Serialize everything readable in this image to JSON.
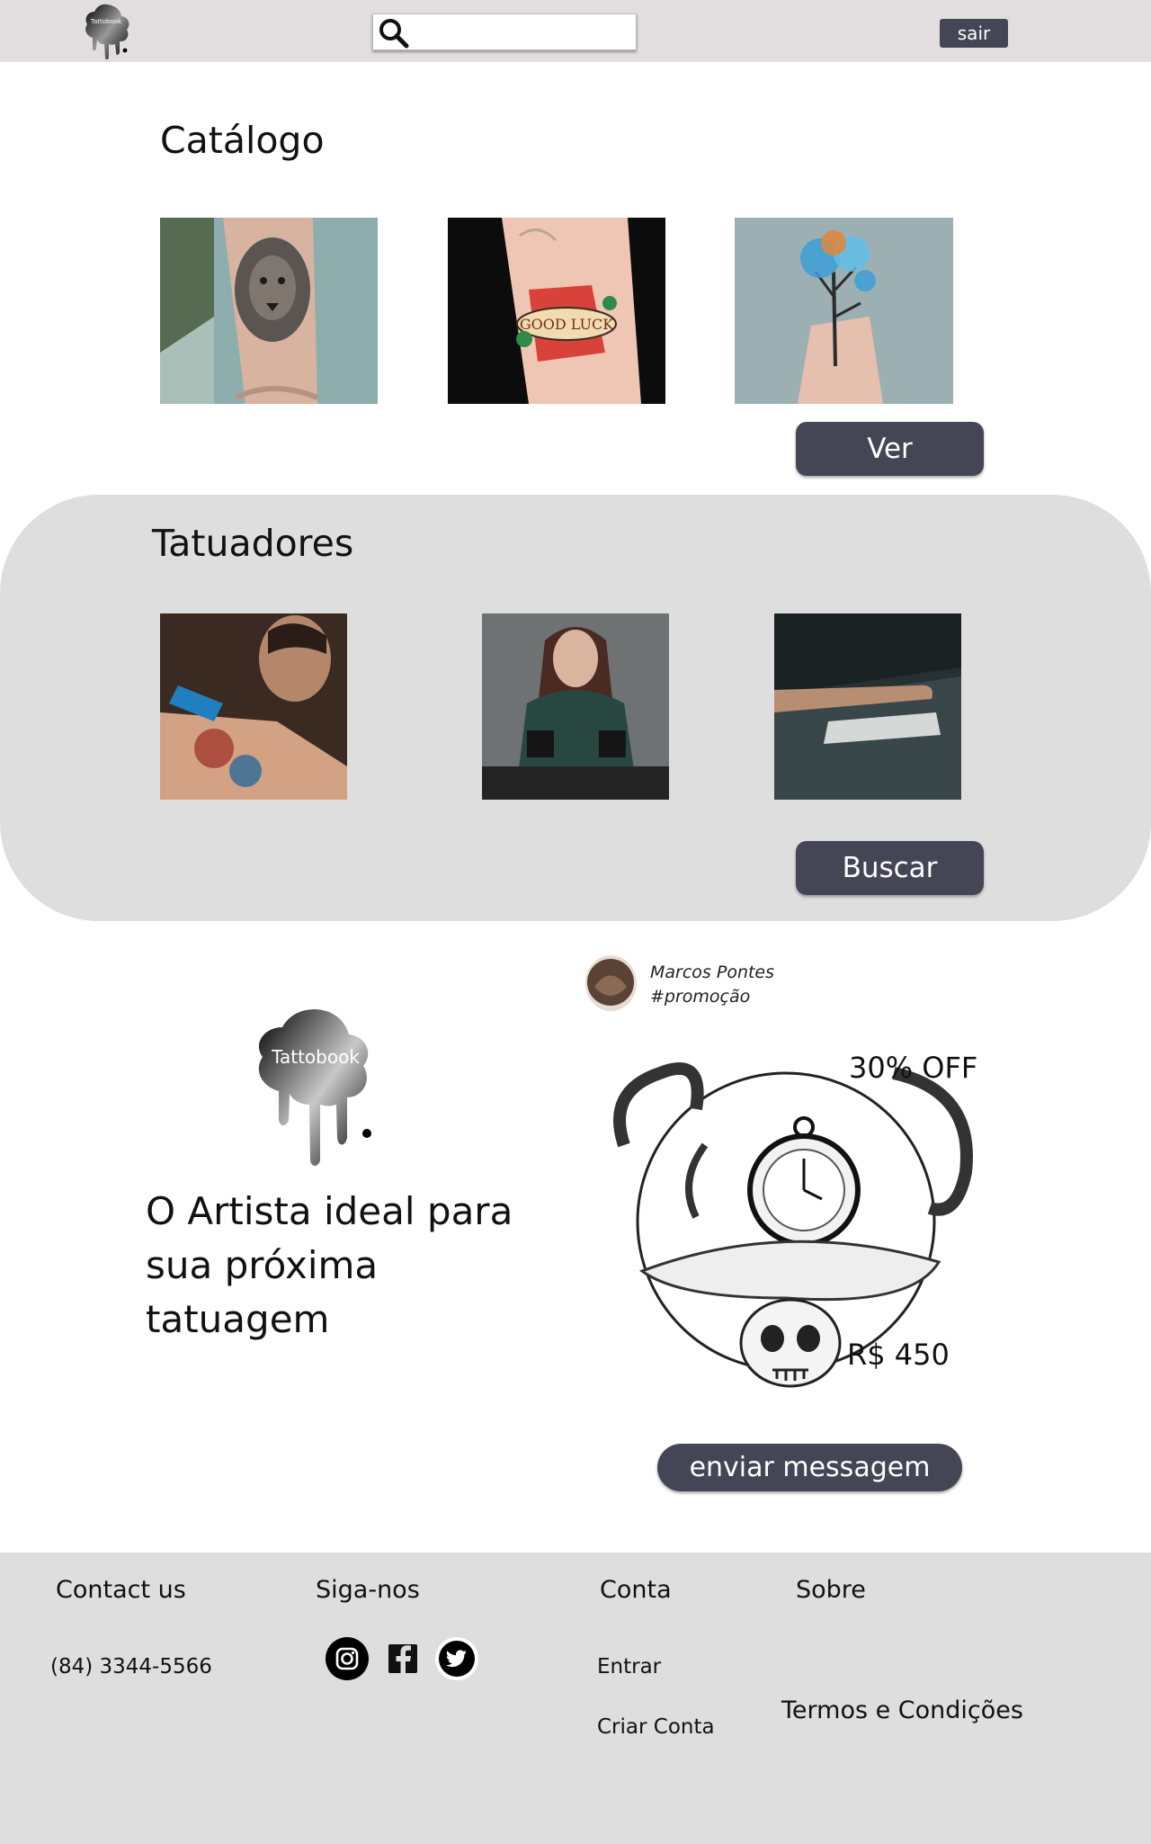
{
  "header": {
    "logo_text": "Tattobook",
    "search": {
      "placeholder": "",
      "value": ""
    },
    "logout_label": "sair",
    "icons": [
      "tattobook-logo",
      "search-icon"
    ]
  },
  "catalog": {
    "title": "Catálogo",
    "items": [
      {
        "image": "lion-forearm-tattoo"
      },
      {
        "image": "good-luck-horseshoe-tattoo"
      },
      {
        "image": "watercolor-tree-wrist-tattoo"
      }
    ],
    "view_label": "Ver"
  },
  "artists": {
    "title": "Tatuadores",
    "items": [
      {
        "image": "artist-tattooing-arm"
      },
      {
        "image": "female-artist-with-machine"
      },
      {
        "image": "arm-on-tattoo-table"
      }
    ],
    "search_label": "Buscar"
  },
  "promo": {
    "brand": "Tattobook",
    "headline": "O Artista ideal para sua próxima tatuagem",
    "post": {
      "author": "Marcos Pontes",
      "tag": "#promoção",
      "discount": "30% OFF",
      "price": "R$ 450",
      "image": "pocket-watch-skull-octopus-illustration"
    },
    "message_label": "enviar messagem"
  },
  "footer": {
    "contact": {
      "title": "Contact us",
      "phone": "(84) 3344-5566"
    },
    "follow": {
      "title": "Siga-nos",
      "icons": [
        "instagram-icon",
        "facebook-icon",
        "twitter-icon"
      ]
    },
    "account": {
      "title": "Conta",
      "links": [
        "Entrar",
        "Criar Conta"
      ]
    },
    "about": {
      "title": "Sobre",
      "terms": "Termos e Condições"
    }
  },
  "colors": {
    "header_bg": "#e2dedf",
    "button_dark": "#454655",
    "panel_bg": "#dedede",
    "footer_bg": "#dedede",
    "page_bg": "#ffffff"
  }
}
